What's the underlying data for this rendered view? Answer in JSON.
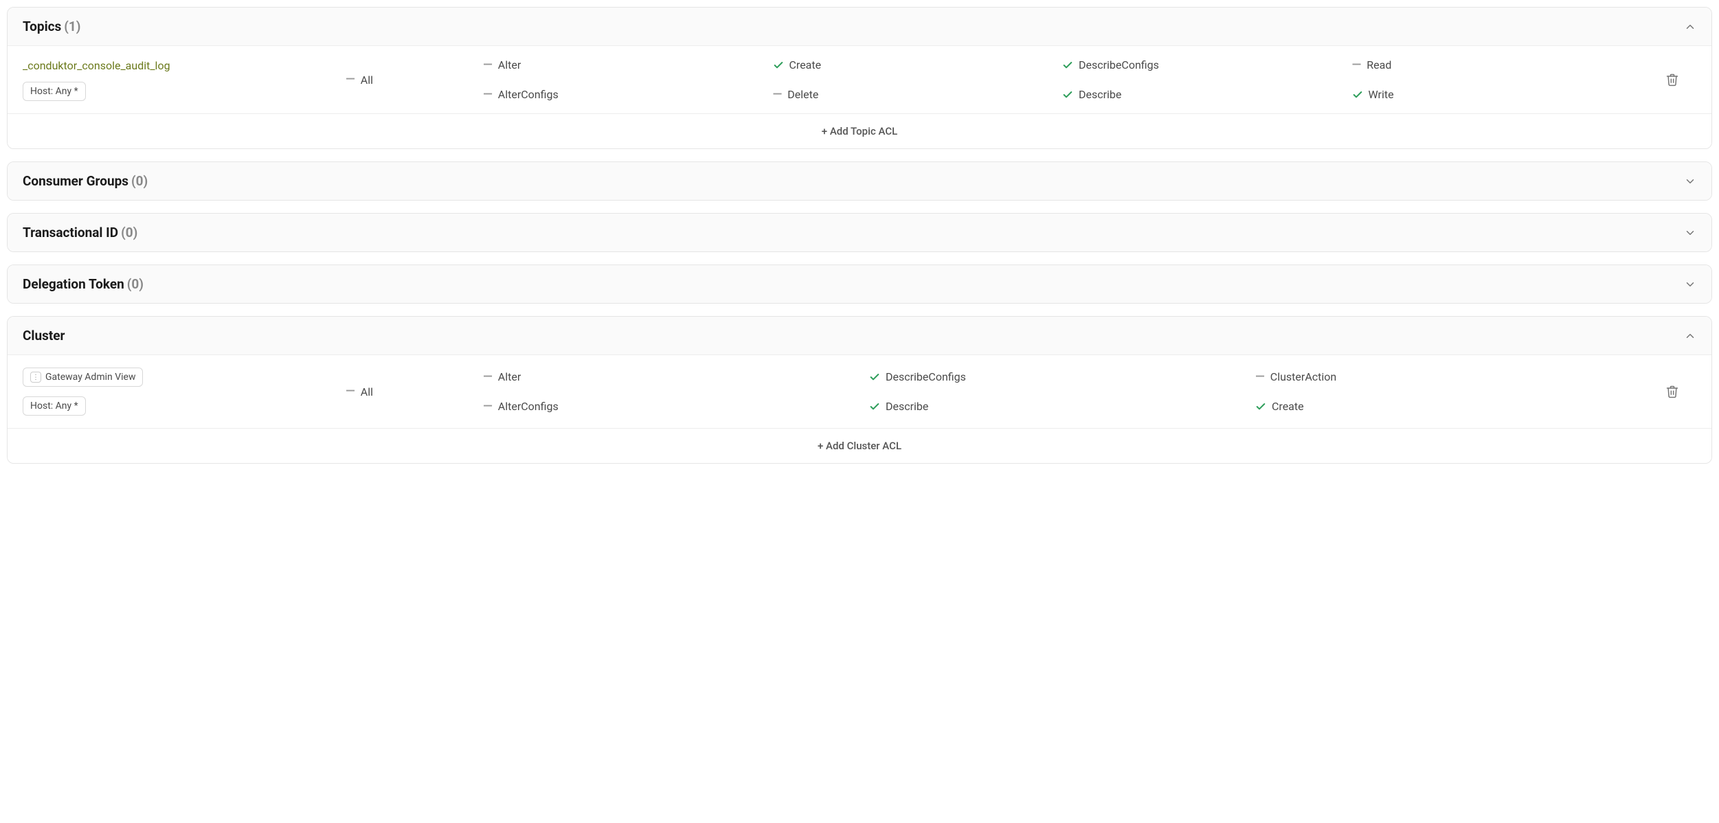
{
  "sections": {
    "topics": {
      "title": "Topics",
      "count": "(1)",
      "addLabel": "+ Add Topic ACL"
    },
    "consumerGroups": {
      "title": "Consumer Groups",
      "count": "(0)"
    },
    "transactionalId": {
      "title": "Transactional ID",
      "count": "(0)"
    },
    "delegationToken": {
      "title": "Delegation Token",
      "count": "(0)"
    },
    "cluster": {
      "title": "Cluster",
      "addLabel": "+ Add Cluster ACL"
    }
  },
  "topicRow": {
    "name": "_conduktor_console_audit_log",
    "host": "Host: Any *",
    "all": "All",
    "perms": {
      "alter": "Alter",
      "create": "Create",
      "describeConfigs": "DescribeConfigs",
      "read": "Read",
      "alterConfigs": "AlterConfigs",
      "delete": "Delete",
      "describe": "Describe",
      "write": "Write"
    }
  },
  "clusterRow": {
    "name": "Gateway Admin View",
    "host": "Host: Any *",
    "all": "All",
    "perms": {
      "alter": "Alter",
      "describeConfigs": "DescribeConfigs",
      "clusterAction": "ClusterAction",
      "alterConfigs": "AlterConfigs",
      "describe": "Describe",
      "create": "Create"
    }
  }
}
